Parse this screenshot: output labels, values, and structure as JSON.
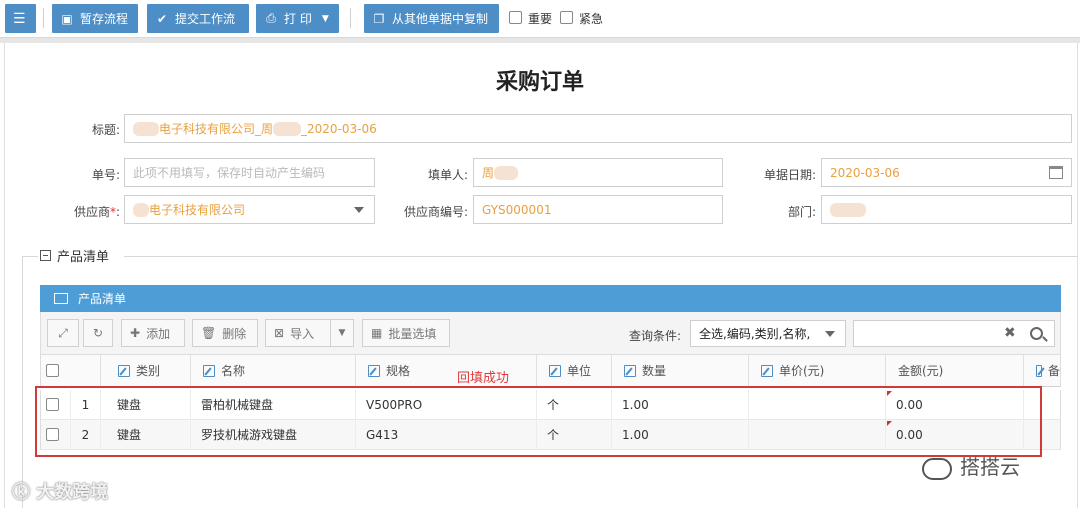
{
  "toolbar": {
    "save_draft": "暂存流程",
    "submit": "提交工作流",
    "print": "打 印",
    "copy_from": "从其他单据中复制",
    "important": "重要",
    "urgent": "紧急"
  },
  "form": {
    "title": "采购订单",
    "subject_label": "标题:",
    "subject_value": "电子科技有限公司_周",
    "subject_date": "_2020-03-06",
    "number_label": "单号:",
    "number_placeholder": "此项不用填写，保存时自动产生编码",
    "filler_label": "填单人:",
    "filler_value": "周",
    "date_label": "单据日期:",
    "date_value": "2020-03-06",
    "supplier_label": "供应商",
    "supplier_required": "*",
    "supplier_colon": ":",
    "supplier_value": "电子科技有限公司",
    "supplier_code_label": "供应商编号:",
    "supplier_code_value": "GYS000001",
    "dept_label": "部门:",
    "dept_value": ""
  },
  "section": {
    "legend": "产品清单",
    "panel_title": "产品清单"
  },
  "grid_toolbar": {
    "add": "添加",
    "delete": "删除",
    "import": "导入",
    "batch": "批量选填",
    "query_label": "查询条件:",
    "query_value": "全选,编码,类别,名称,"
  },
  "table": {
    "columns": [
      "类别",
      "名称",
      "规格",
      "单位",
      "数量",
      "单价(元)",
      "金额(元)",
      "备"
    ],
    "rows": [
      {
        "no": "1",
        "category": "键盘",
        "name": "雷柏机械键盘",
        "spec": "V500PRO",
        "unit": "个",
        "qty": "1.00",
        "price": "",
        "amount": "0.00"
      },
      {
        "no": "2",
        "category": "键盘",
        "name": "罗技机械游戏键盘",
        "spec": "G413",
        "unit": "个",
        "qty": "1.00",
        "price": "",
        "amount": "0.00"
      }
    ]
  },
  "annotation": "回填成功",
  "watermarks": {
    "left": "大数跨境",
    "right": "搭搭云"
  }
}
